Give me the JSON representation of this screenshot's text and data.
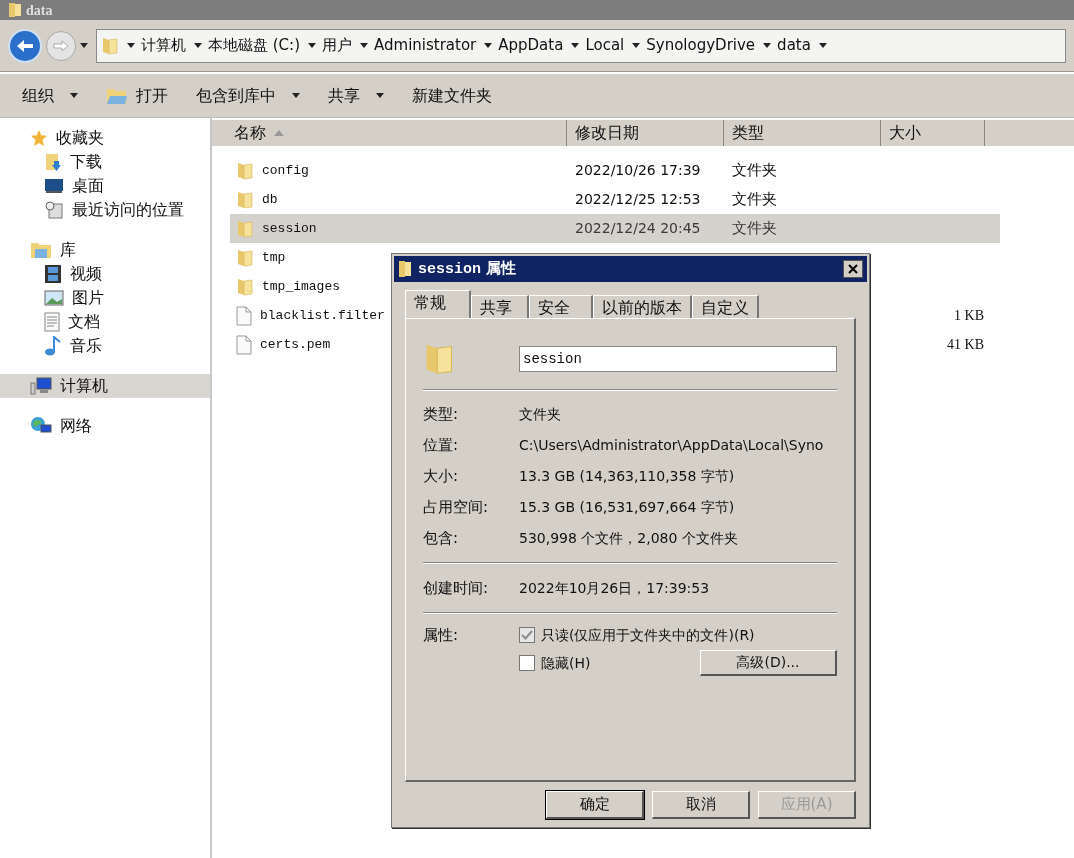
{
  "window": {
    "title": "data"
  },
  "address_bar": {
    "path": [
      "计算机",
      "本地磁盘 (C:)",
      "用户",
      "Administrator",
      "AppData",
      "Local",
      "SynologyDrive",
      "data"
    ]
  },
  "toolbar": [
    {
      "label": "组织",
      "kind": "menu"
    },
    {
      "label": "打开",
      "kind": "open"
    },
    {
      "label": "包含到库中",
      "kind": "menu"
    },
    {
      "label": "共享",
      "kind": "menu"
    },
    {
      "label": "新建文件夹",
      "kind": "plain"
    }
  ],
  "sidebar": {
    "groups": [
      {
        "label": "收藏夹",
        "kind": "star",
        "selected": false,
        "children": [
          {
            "label": "下载",
            "kind": "download",
            "selected": false
          },
          {
            "label": "桌面",
            "kind": "desktop",
            "selected": false
          },
          {
            "label": "最近访问的位置",
            "kind": "recent",
            "selected": false
          }
        ]
      },
      {
        "label": "库",
        "kind": "library",
        "selected": false,
        "children": [
          {
            "label": "视频",
            "kind": "video",
            "selected": false
          },
          {
            "label": "图片",
            "kind": "image",
            "selected": false
          },
          {
            "label": "文档",
            "kind": "document",
            "selected": false
          },
          {
            "label": "音乐",
            "kind": "music",
            "selected": false
          }
        ]
      },
      {
        "label": "计算机",
        "kind": "computer",
        "selected": true
      },
      {
        "label": "网络",
        "kind": "network",
        "selected": false
      }
    ]
  },
  "table": {
    "columns": [
      "名称",
      "修改日期",
      "类型",
      "大小"
    ],
    "rows": [
      {
        "name": "config",
        "kind": "folder",
        "modified": "2022/10/26 17:39",
        "type": "文件夹",
        "selected": false
      },
      {
        "name": "db",
        "kind": "folder",
        "modified": "2022/12/25 12:53",
        "type": "文件夹",
        "selected": false
      },
      {
        "name": "session",
        "kind": "folder",
        "modified": "2022/12/24 20:45",
        "type": "文件夹",
        "selected": true
      },
      {
        "name": "tmp",
        "kind": "folder",
        "selected": false
      },
      {
        "name": "tmp_images",
        "kind": "folder",
        "selected": false
      },
      {
        "name": "blacklist.filter",
        "kind": "file",
        "size": "1 KB",
        "selected": false
      },
      {
        "name": "certs.pem",
        "kind": "file",
        "size": "41 KB",
        "selected": false
      }
    ]
  },
  "dialog": {
    "title_name": "session",
    "title_suffix": "属性",
    "tabs": [
      {
        "label": "常规",
        "selected": true
      },
      {
        "label": "共享",
        "selected": false
      },
      {
        "label": "安全",
        "selected": false
      },
      {
        "label": "以前的版本",
        "selected": false
      },
      {
        "label": "自定义",
        "selected": false
      }
    ],
    "name_field": "session",
    "info": [
      {
        "label": "类型:",
        "value": "文件夹"
      },
      {
        "label": "位置:",
        "value": "C:\\Users\\Administrator\\AppData\\Local\\Syno"
      },
      {
        "label": "大小:",
        "value": "13.3 GB (14,363,110,358 字节)"
      },
      {
        "label": "占用空间:",
        "value": "15.3 GB (16,531,697,664 字节)"
      },
      {
        "label": "包含:",
        "value": "530,998 个文件，2,080 个文件夹"
      }
    ],
    "created": {
      "label": "创建时间:",
      "value": "2022年10月26日，17:39:53"
    },
    "attributes_label": "属性:",
    "attributes": [
      {
        "label": "只读(仅应用于文件夹中的文件)(R)",
        "checked": true,
        "disabled": true
      },
      {
        "label": "隐藏(H)",
        "checked": false,
        "disabled": false
      }
    ],
    "advanced_button": "高级(D)...",
    "buttons": [
      {
        "label": "确定",
        "disabled": false,
        "default": true
      },
      {
        "label": "取消",
        "disabled": false,
        "default": false
      },
      {
        "label": "应用(A)",
        "disabled": true,
        "default": false
      }
    ]
  }
}
